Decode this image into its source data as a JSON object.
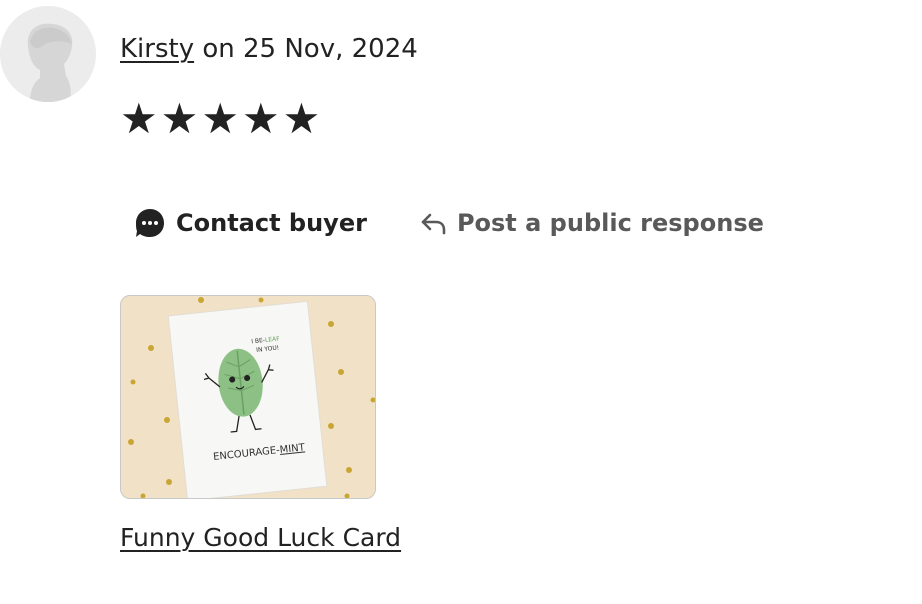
{
  "review": {
    "reviewer_name": "Kirsty",
    "date_text": "on 25 Nov, 2024",
    "rating": 5,
    "rating_max": 5,
    "star_glyph": "★"
  },
  "actions": {
    "contact_label": "Contact buyer",
    "contact_icon": "chat-bubble-icon",
    "respond_label": "Post a public response",
    "respond_icon": "reply-arrow-icon"
  },
  "product": {
    "name": "Funny Good Luck Card",
    "card_text_top_1": "I BE-",
    "card_text_top_1_accent": "LEAF",
    "card_text_top_2": "IN YOU!",
    "card_text_bottom": "ENCOURAGE-",
    "card_text_bottom_accent": "MINT"
  },
  "colors": {
    "text": "#222222",
    "muted": "#595959",
    "avatar_bg": "#ececec",
    "product_bg": "#f1e1c6",
    "leaf_green": "#8cc084",
    "gold_dot": "#c9a533"
  }
}
